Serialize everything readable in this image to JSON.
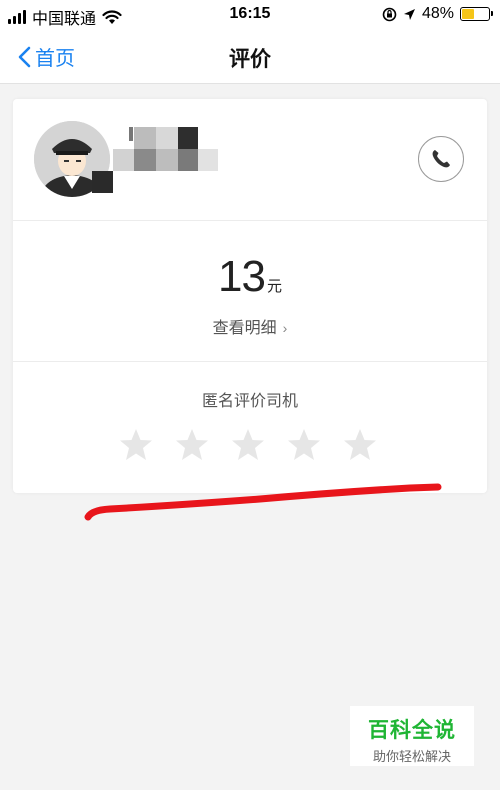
{
  "status_bar": {
    "carrier": "中国联通",
    "time": "16:15",
    "battery_percent": "48%",
    "battery_level": 0.48,
    "battery_color": "#f5c518"
  },
  "nav": {
    "back_label": "首页",
    "title": "评价",
    "accent_color": "#1a82f0"
  },
  "driver": {
    "avatar_icon": "driver-avatar-icon",
    "phone_icon": "phone-icon"
  },
  "fare": {
    "amount": "13",
    "unit": "元",
    "detail_label": "查看明细",
    "detail_chevron": "›"
  },
  "rating": {
    "label": "匿名评价司机",
    "stars_total": 5,
    "stars_selected": 0,
    "star_color": "#e6e6e6"
  },
  "watermark": {
    "brand": "百科全说",
    "slogan": "助你轻松解决",
    "brand_color": "#1fb534"
  }
}
